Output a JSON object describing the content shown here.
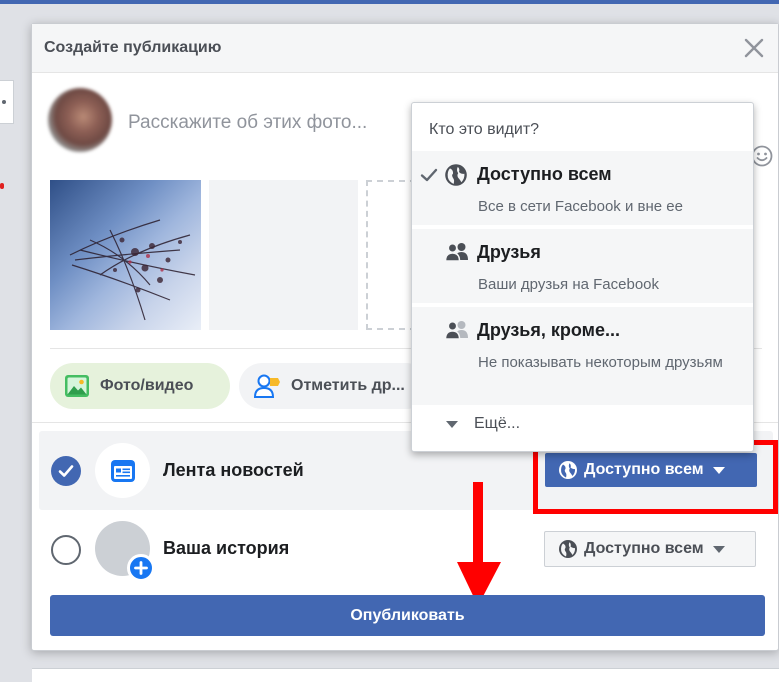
{
  "dialog": {
    "title": "Создайте публикацию",
    "composer_placeholder": "Расскажите об этих фото..."
  },
  "actions": {
    "photo_video": "Фото/видео",
    "tag_friends": "Отметить др..."
  },
  "destinations": {
    "news_feed": {
      "label": "Лента новостей",
      "audience": "Доступно всем",
      "selected": true
    },
    "story": {
      "label": "Ваша история",
      "audience": "Доступно всем",
      "selected": false
    }
  },
  "publish_label": "Опубликовать",
  "audience_menu": {
    "header": "Кто это видит?",
    "options": [
      {
        "title": "Доступно всем",
        "description": "Все в сети Facebook и вне ее",
        "icon": "globe-icon",
        "checked": true
      },
      {
        "title": "Друзья",
        "description": "Ваши друзья на Facebook",
        "icon": "friends-icon",
        "checked": false
      },
      {
        "title": "Друзья, кроме...",
        "description": "Не показывать некоторым друзьям",
        "icon": "friends-except-icon",
        "checked": false
      }
    ],
    "more_label": "Ещё..."
  },
  "colors": {
    "facebook_blue": "#4267b2",
    "annotation_red": "#ff0000",
    "photo_pill_green": "#e6f2dc"
  }
}
